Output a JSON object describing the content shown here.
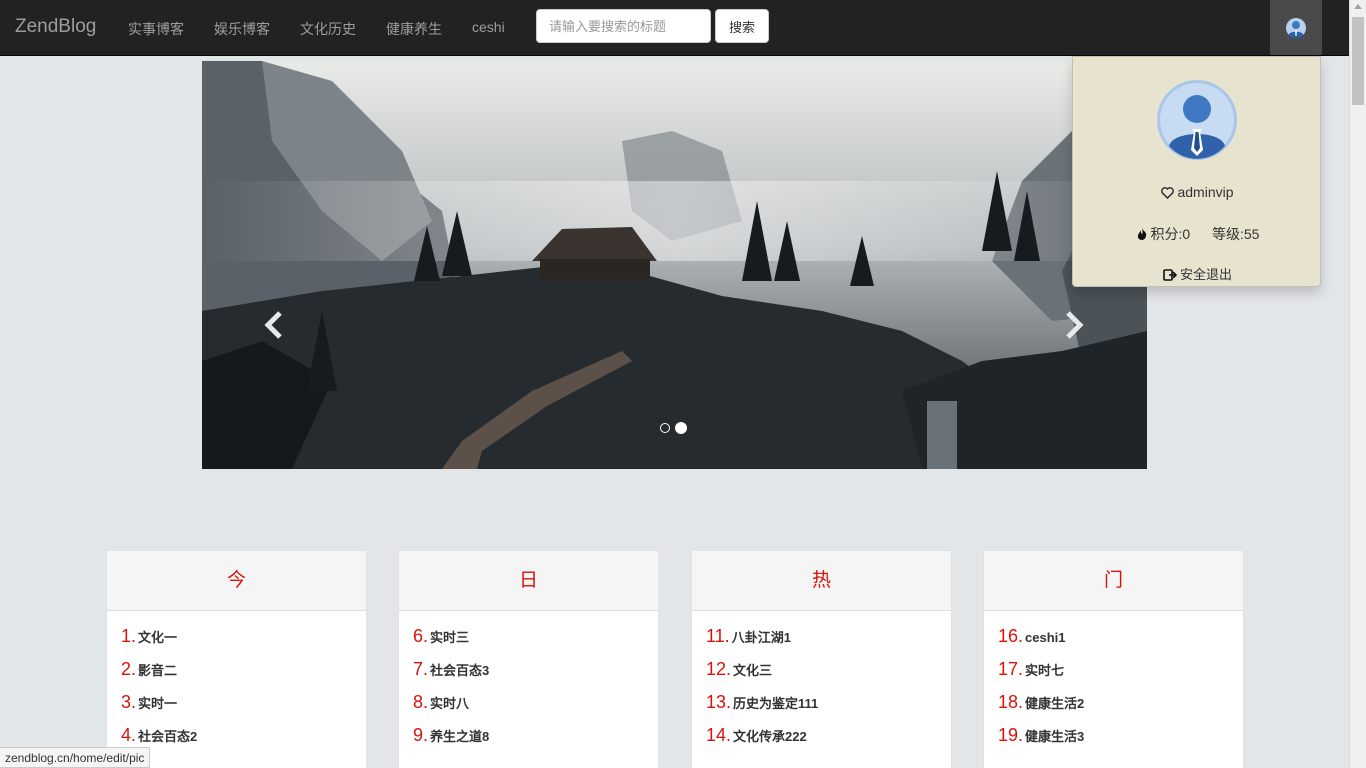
{
  "navbar": {
    "brand": "ZendBlog",
    "links": [
      "实事博客",
      "娱乐博客",
      "文化历史",
      "健康养生",
      "ceshi"
    ],
    "search_placeholder": "请输入要搜索的标题",
    "search_button": "搜索"
  },
  "carousel": {
    "slide_count": 2,
    "active_slide": 2
  },
  "user_dropdown": {
    "username": "adminvip",
    "points_label": "积分:0",
    "level_label": "等级:55",
    "logout_label": "安全退出"
  },
  "hot": {
    "headings": [
      "今",
      "日",
      "热",
      "门"
    ],
    "columns": [
      [
        {
          "num": "1.",
          "title": "文化一"
        },
        {
          "num": "2.",
          "title": "影音二"
        },
        {
          "num": "3.",
          "title": "实时一"
        },
        {
          "num": "4.",
          "title": "社会百态2"
        }
      ],
      [
        {
          "num": "6.",
          "title": "实时三"
        },
        {
          "num": "7.",
          "title": "社会百态3"
        },
        {
          "num": "8.",
          "title": "实时八"
        },
        {
          "num": "9.",
          "title": "养生之道8"
        }
      ],
      [
        {
          "num": "11.",
          "title": "八卦江湖1"
        },
        {
          "num": "12.",
          "title": "文化三"
        },
        {
          "num": "13.",
          "title": "历史为鉴定111"
        },
        {
          "num": "14.",
          "title": "文化传承222"
        }
      ],
      [
        {
          "num": "16.",
          "title": "ceshi1"
        },
        {
          "num": "17.",
          "title": "实时七"
        },
        {
          "num": "18.",
          "title": "健康生活2"
        },
        {
          "num": "19.",
          "title": "健康生活3"
        }
      ]
    ]
  },
  "status_url": "zendblog.cn/home/edit/pic",
  "colors": {
    "navbar_bg": "#222222",
    "accent_red": "#d9120c",
    "dropdown_bg": "#e7e3ce"
  }
}
